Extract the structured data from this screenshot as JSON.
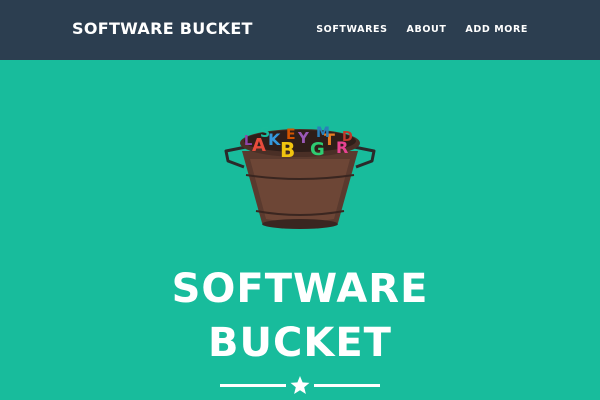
{
  "navbar": {
    "brand": "SOFTWARE BUCKET",
    "links": [
      {
        "label": "SOFTWARES"
      },
      {
        "label": "ABOUT"
      },
      {
        "label": "ADD MORE"
      }
    ]
  },
  "hero": {
    "title_line1": "SOFTWARE",
    "title_line2": "BUCKET",
    "image_subject": "bucket filled with colorful alphabet letters",
    "divider_icon": "star-icon"
  },
  "colors": {
    "navbar_bg": "#2c3e50",
    "hero_bg": "#18bc9c",
    "text": "#ffffff"
  }
}
